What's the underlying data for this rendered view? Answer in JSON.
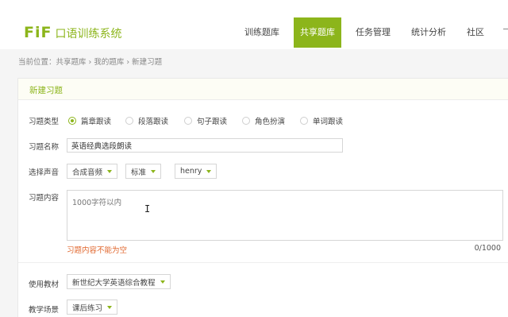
{
  "header": {
    "logo_fif": "FiF",
    "logo_name": "口语训练系统",
    "nav": [
      {
        "label": "训练题库",
        "active": false
      },
      {
        "label": "共享题库",
        "active": true
      },
      {
        "label": "任务管理",
        "active": false
      },
      {
        "label": "统计分析",
        "active": false
      },
      {
        "label": "社区",
        "active": false
      }
    ]
  },
  "breadcrumb": "当前位置：共享题库 › 我的题库 › 新建习题",
  "form": {
    "title": "新建习题",
    "type_label": "习题类型",
    "types": [
      "篇章跟读",
      "段落跟读",
      "句子跟读",
      "角色扮演",
      "单词跟读"
    ],
    "selected_type": "篇章跟读",
    "name_label": "习题名称",
    "name_value": "英语经典选段朗读",
    "voice_label": "选择声音",
    "voice_source": "合成音频",
    "voice_speed": "标准",
    "voice_name": "henry",
    "content_label": "习题内容",
    "content_placeholder": "1000字符以内",
    "content_error": "习题内容不能为空",
    "content_counter": "0/1000",
    "textbook_label": "使用教材",
    "textbook_value": "新世纪大学英语综合教程",
    "scene_label": "教学场景",
    "scene_value": "课后练习"
  },
  "colors": {
    "accent": "#8cb51b",
    "error": "#e0662c"
  }
}
